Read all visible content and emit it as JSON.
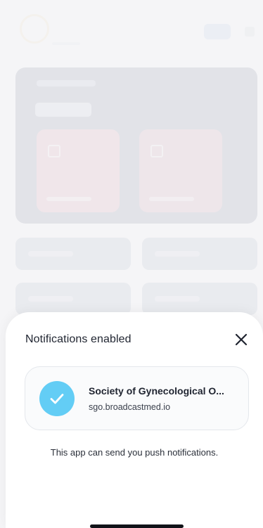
{
  "background": {
    "description": "dimmed app content behind sheet"
  },
  "sheet": {
    "title": "Notifications enabled",
    "close_icon": "close-icon",
    "app_card": {
      "name": "Society of Gynecological O...",
      "domain": "sgo.broadcastmed.io",
      "status_icon": "check-icon",
      "status_color": "#63cdf5"
    },
    "note": "This app can send you push notifications."
  }
}
